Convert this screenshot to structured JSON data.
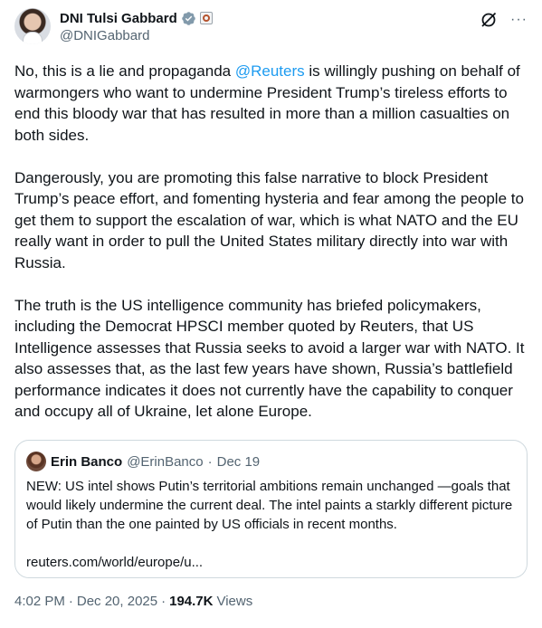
{
  "author": {
    "display_name": "DNI Tulsi Gabbard",
    "handle": "@DNIGabbard",
    "verified_color": "#829aab"
  },
  "actions": {
    "grok_icon": "grok-slash-icon",
    "more_icon": "more-horizontal-icon",
    "more_glyph": "···"
  },
  "tweet": {
    "paragraphs": [
      {
        "before": "No, this is a lie and propaganda ",
        "mention": "@Reuters",
        "after": " is willingly pushing on behalf of warmongers who want to undermine President Trump’s tireless efforts to end this bloody war that has resulted in more than a million casualties on both sides."
      },
      {
        "text": "Dangerously, you are promoting this false narrative to block President Trump’s peace effort, and fomenting hysteria and fear among the people to get them to support the escalation of war, which is what NATO and the EU really want in order to pull the United States military directly into war with Russia."
      },
      {
        "text": "The truth is the US intelligence community has briefed policymakers, including the Democrat HPSCI member quoted by Reuters, that US Intelligence assesses that Russia seeks to avoid a larger war with NATO. It also assesses that, as the last few years have shown, Russia’s battlefield performance indicates it does not currently have the capability to conquer and occupy all of Ukraine, let alone Europe."
      }
    ]
  },
  "quote": {
    "display_name": "Erin Banco",
    "handle": "@ErinBanco",
    "separator": "·",
    "date": "Dec 19",
    "text": "NEW: US intel shows Putin’s territorial ambitions remain unchanged —goals that would likely undermine the current deal. The intel paints a starkly different picture of Putin than the one painted by US officials in recent months.",
    "link": "reuters.com/world/europe/u..."
  },
  "meta": {
    "time": "4:02 PM",
    "separator": "·",
    "date": "Dec 20, 2025",
    "separator2": "·",
    "views_count": "194.7K",
    "views_label": "Views"
  },
  "colors": {
    "link": "#1d9bf0",
    "secondary_text": "#536471",
    "border": "#cfd9de"
  }
}
